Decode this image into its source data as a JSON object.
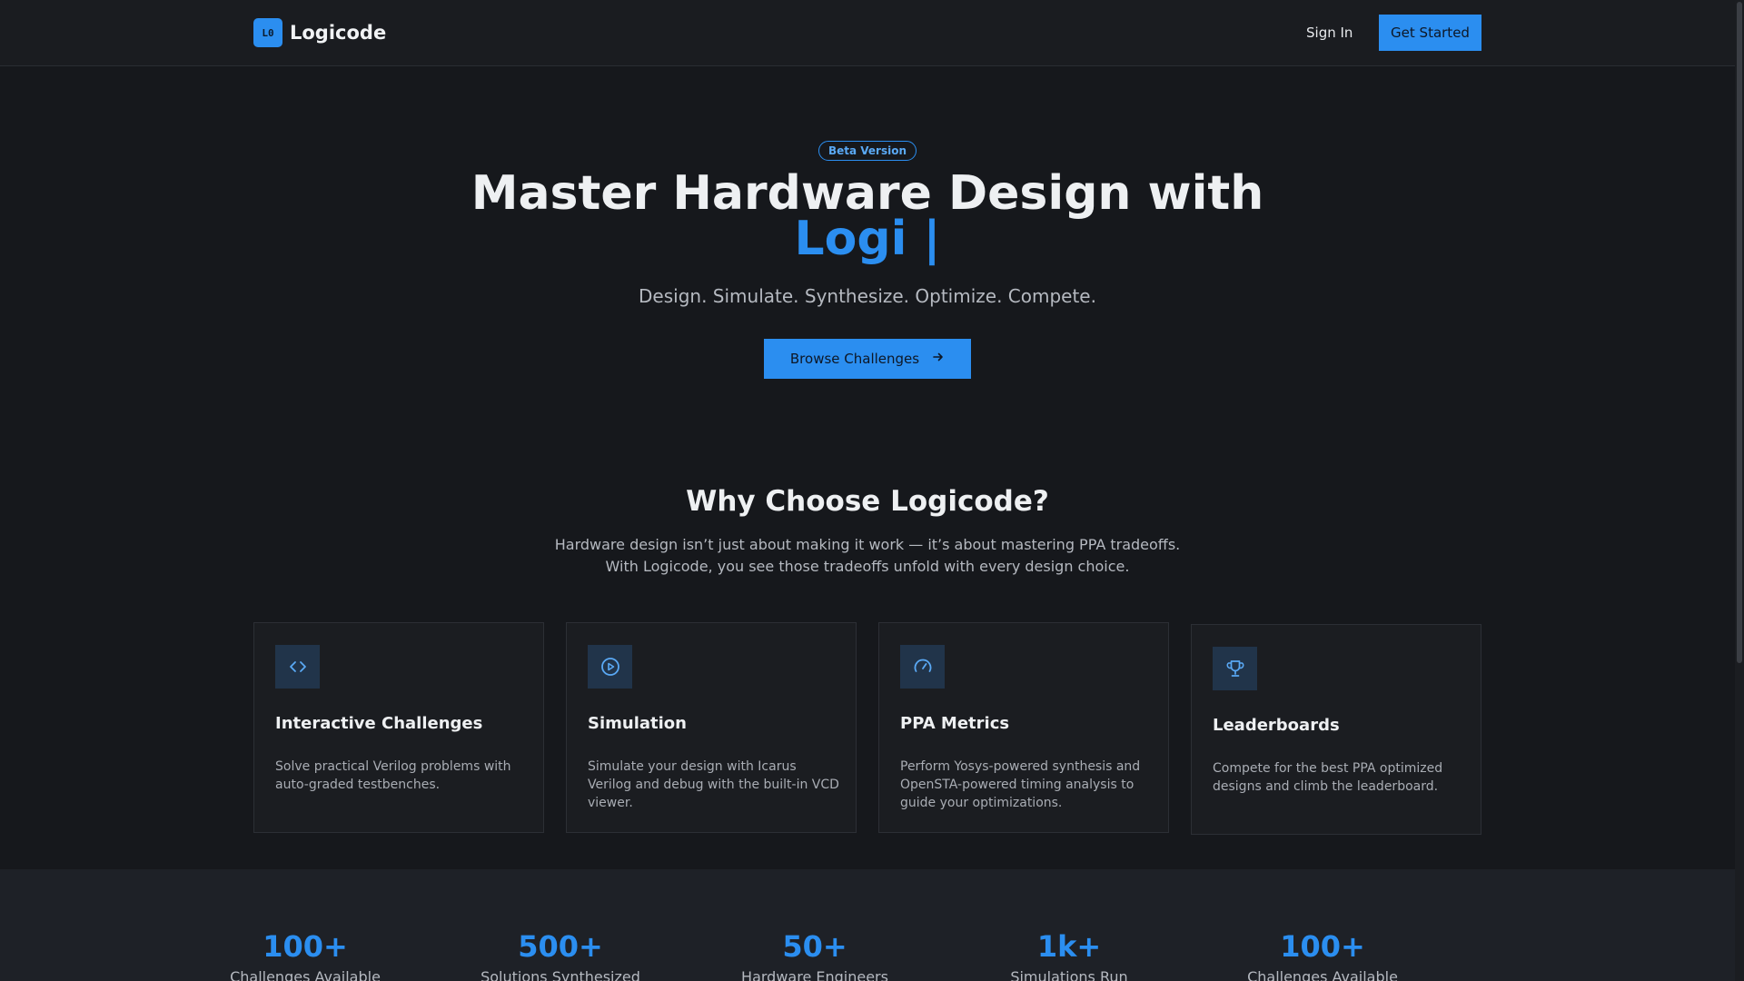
{
  "header": {
    "logo_badge": "L0",
    "logo_name": "Logicode",
    "sign_in": "Sign In",
    "get_started": "Get Started"
  },
  "hero": {
    "badge": "Beta Version",
    "title_line1": "Master Hardware Design with",
    "title_accent": "Logi |",
    "tagline": "Design. Simulate. Synthesize. Optimize. Compete.",
    "cta": "Browse Challenges",
    "cta_icon": "arrow-right-icon"
  },
  "why": {
    "title": "Why Choose Logicode?",
    "description": "Hardware design isn’t just about making it work — it’s about mastering PPA tradeoffs. With Logicode, you see those tradeoffs unfold with every design choice."
  },
  "features": [
    {
      "icon": "code-icon",
      "title": "Interactive Challenges",
      "description": "Solve practical Verilog problems with auto-graded testbenches."
    },
    {
      "icon": "play-circle-icon",
      "title": "Simulation",
      "description": "Simulate your design with Icarus Verilog and debug with the built-in VCD viewer."
    },
    {
      "icon": "gauge-icon",
      "title": "PPA Metrics",
      "description": "Perform Yosys-powered synthesis and OpenSTA-powered timing analysis to guide your optimizations."
    },
    {
      "icon": "trophy-icon",
      "title": "Leaderboards",
      "description": "Compete for the best PPA optimized designs and climb the leaderboard."
    }
  ],
  "stats": [
    {
      "value": "100+",
      "label": "Challenges Available"
    },
    {
      "value": "500+",
      "label": "Solutions Synthesized"
    },
    {
      "value": "50+",
      "label": "Hardware Engineers"
    },
    {
      "value": "1k+",
      "label": "Simulations Run"
    },
    {
      "value": "100+",
      "label": "Challenges Available"
    }
  ],
  "colors": {
    "accent": "#2b8ef0",
    "background": "#16181c",
    "card": "#1b1d21"
  }
}
